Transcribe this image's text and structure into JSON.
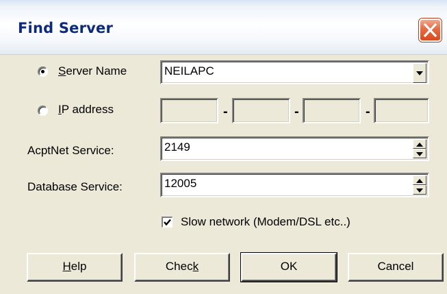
{
  "window": {
    "title": "Find Server"
  },
  "server_name": {
    "label_prefix": "",
    "label_accel": "S",
    "label_rest": "erver Name",
    "value": "NEILAPC",
    "selected": true
  },
  "ip_address": {
    "label_accel": "I",
    "label_rest": "P address",
    "separator": "-",
    "octets": [
      "",
      "",
      "",
      ""
    ],
    "selected": false
  },
  "acptnet_service": {
    "label": "AcptNet Service:",
    "value": "2149"
  },
  "database_service": {
    "label": "Database Service:",
    "value": "12005"
  },
  "slow_network": {
    "label": "Slow network (Modem/DSL etc..)",
    "checked": true
  },
  "buttons": {
    "help": {
      "accel": "H",
      "rest": "elp"
    },
    "check": {
      "prefix": "Chec",
      "accel": "k"
    },
    "ok": {
      "label": "OK"
    },
    "cancel": {
      "label": "Cancel"
    }
  },
  "icons": {
    "close": "close-icon",
    "dropdown": "chevron-down-icon",
    "spin_up": "triangle-up-icon",
    "spin_down": "triangle-down-icon",
    "check": "checkmark-icon"
  }
}
